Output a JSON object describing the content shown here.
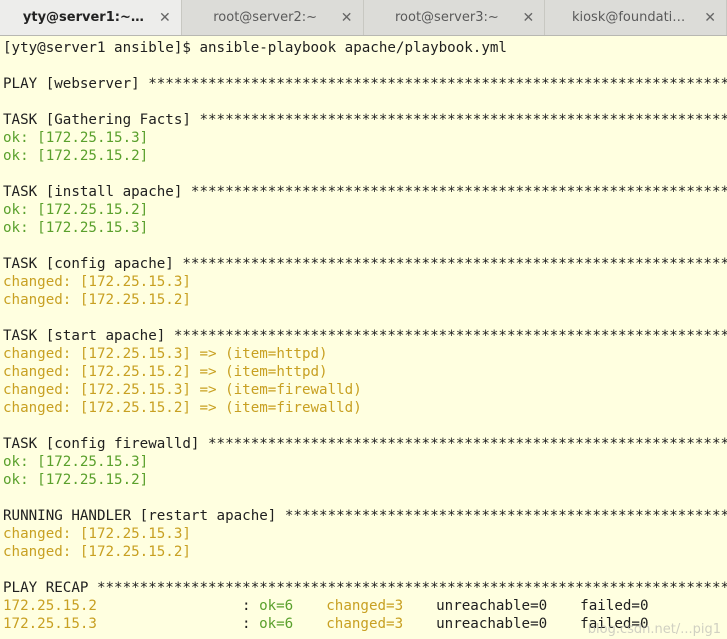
{
  "tabs": [
    {
      "label": "yty@server1:~…",
      "active": true
    },
    {
      "label": "root@server2:~",
      "active": false
    },
    {
      "label": "root@server3:~",
      "active": false
    },
    {
      "label": "kiosk@foundati…",
      "active": false
    }
  ],
  "lines": [
    {
      "text": "[yty@server1 ansible]$ ansible-playbook apache/playbook.yml",
      "style": "normal"
    },
    {
      "text": "",
      "style": "normal"
    },
    {
      "text": "PLAY [webserver] *********************************************************************",
      "style": "normal"
    },
    {
      "text": "",
      "style": "normal"
    },
    {
      "text": "TASK [Gathering Facts] ***************************************************************",
      "style": "normal"
    },
    {
      "text": "ok: [172.25.15.3]",
      "style": "ok"
    },
    {
      "text": "ok: [172.25.15.2]",
      "style": "ok"
    },
    {
      "text": "",
      "style": "normal"
    },
    {
      "text": "TASK [install apache] ****************************************************************",
      "style": "normal"
    },
    {
      "text": "ok: [172.25.15.2]",
      "style": "ok"
    },
    {
      "text": "ok: [172.25.15.3]",
      "style": "ok"
    },
    {
      "text": "",
      "style": "normal"
    },
    {
      "text": "TASK [config apache] *****************************************************************",
      "style": "normal"
    },
    {
      "text": "changed: [172.25.15.3]",
      "style": "changed"
    },
    {
      "text": "changed: [172.25.15.2]",
      "style": "changed"
    },
    {
      "text": "",
      "style": "normal"
    },
    {
      "text": "TASK [start apache] ******************************************************************",
      "style": "normal"
    },
    {
      "text": "changed: [172.25.15.3] => (item=httpd)",
      "style": "changed"
    },
    {
      "text": "changed: [172.25.15.2] => (item=httpd)",
      "style": "changed"
    },
    {
      "text": "changed: [172.25.15.3] => (item=firewalld)",
      "style": "changed"
    },
    {
      "text": "changed: [172.25.15.2] => (item=firewalld)",
      "style": "changed"
    },
    {
      "text": "",
      "style": "normal"
    },
    {
      "text": "TASK [config firewalld] **************************************************************",
      "style": "normal"
    },
    {
      "text": "ok: [172.25.15.3]",
      "style": "ok"
    },
    {
      "text": "ok: [172.25.15.2]",
      "style": "ok"
    },
    {
      "text": "",
      "style": "normal"
    },
    {
      "text": "RUNNING HANDLER [restart apache] *****************************************************",
      "style": "normal"
    },
    {
      "text": "changed: [172.25.15.3]",
      "style": "changed"
    },
    {
      "text": "changed: [172.25.15.2]",
      "style": "changed"
    },
    {
      "text": "",
      "style": "normal"
    },
    {
      "text": "PLAY RECAP ***************************************************************************",
      "style": "normal"
    }
  ],
  "recap": [
    {
      "host": "172.25.15.2",
      "sep": ": ",
      "ok": "ok=6",
      "changed": "changed=3",
      "unreachable": "unreachable=0",
      "failed": "failed=0"
    },
    {
      "host": "172.25.15.3",
      "sep": ": ",
      "ok": "ok=6",
      "changed": "changed=3",
      "unreachable": "unreachable=0",
      "failed": "failed=0"
    }
  ],
  "colors": {
    "ok": "#5aa02c",
    "changed": "#c8a022",
    "background": "#ffffe0"
  },
  "watermark": "blog.csdn.net/...pig1"
}
